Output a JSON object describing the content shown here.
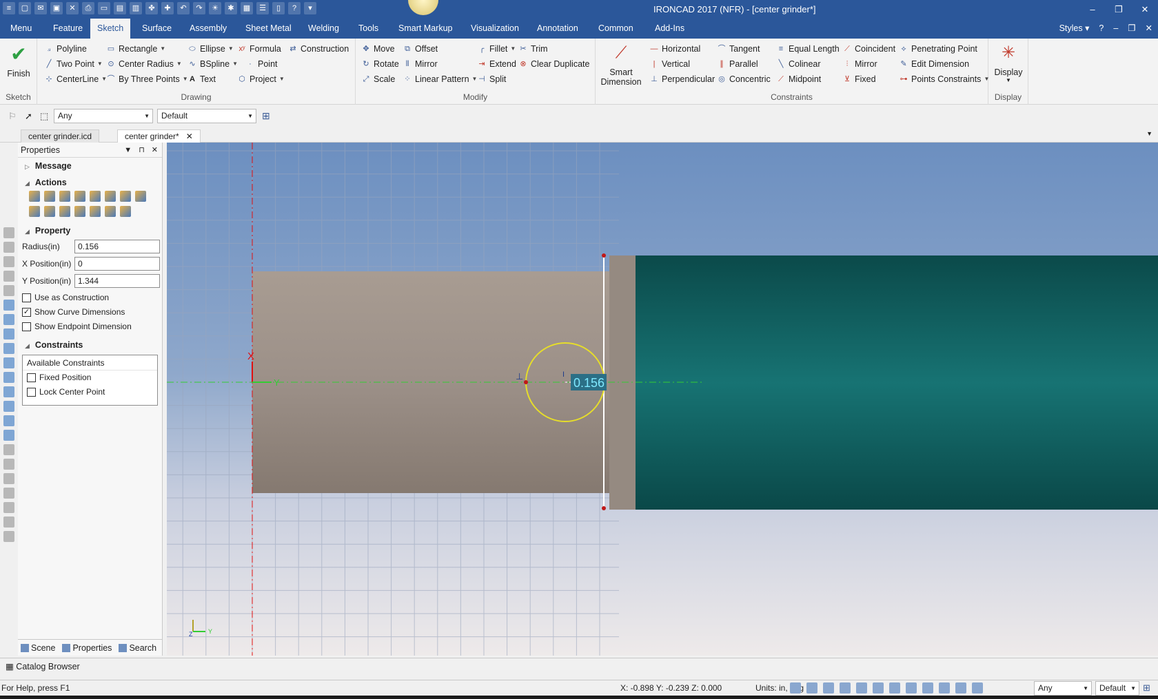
{
  "window": {
    "title": "IRONCAD 2017 (NFR) - [center grinder*]",
    "minimize": "–",
    "restore": "❐",
    "close": "✕"
  },
  "menu": {
    "tabs": [
      "Menu",
      "Feature",
      "Sketch",
      "Surface",
      "Assembly",
      "Sheet Metal",
      "Welding",
      "Tools",
      "Smart Markup",
      "Visualization",
      "Annotation",
      "Common",
      "Add-Ins"
    ],
    "active_tab": "Sketch",
    "styles_label": "Styles",
    "help_icon": "?"
  },
  "ribbon": {
    "sketch_group": {
      "label": "Sketch",
      "finish": "Finish"
    },
    "drawing_group": {
      "label": "Drawing",
      "polyline": "Polyline",
      "rectangle": "Rectangle",
      "ellipse": "Ellipse",
      "formula": "Formula",
      "construction": "Construction",
      "two_point": "Two Point",
      "center_radius": "Center Radius",
      "bspline": "BSpline",
      "point": "Point",
      "centerline": "CenterLine",
      "by_three_points": "By Three Points",
      "text": "Text",
      "project": "Project"
    },
    "modify_group": {
      "label": "Modify",
      "move": "Move",
      "offset": "Offset",
      "fillet": "Fillet",
      "trim": "Trim",
      "rotate": "Rotate",
      "mirror": "Mirror",
      "extend": "Extend",
      "clear_duplicate": "Clear Duplicate",
      "scale": "Scale",
      "linear_pattern": "Linear Pattern",
      "split": "Split"
    },
    "constraints_group": {
      "label": "Constraints",
      "smart_dimension": "Smart Dimension",
      "horizontal": "Horizontal",
      "tangent": "Tangent",
      "equal_length": "Equal Length",
      "coincident": "Coincident",
      "penetrating_point": "Penetrating Point",
      "vertical": "Vertical",
      "parallel": "Parallel",
      "colinear": "Colinear",
      "mirror": "Mirror",
      "edit_dimension": "Edit Dimension",
      "perpendicular": "Perpendicular",
      "concentric": "Concentric",
      "midpoint": "Midpoint",
      "fixed": "Fixed",
      "points_constraints": "Points Constraints"
    },
    "display_group": {
      "label": "Display",
      "display": "Display"
    }
  },
  "selection": {
    "filter_value": "Any",
    "style_value": "Default"
  },
  "doc_tabs": [
    {
      "label": "center grinder.icd",
      "active": false
    },
    {
      "label": "center grinder*",
      "active": true
    }
  ],
  "properties": {
    "title": "Properties",
    "message_label": "Message",
    "actions_label": "Actions",
    "property_label": "Property",
    "radius_label": "Radius(in)",
    "radius_value": "0.156",
    "x_label": "X Position(in)",
    "x_value": "0",
    "y_label": "Y Position(in)",
    "y_value": "1.344",
    "use_construction": "Use as Construction",
    "use_construction_checked": false,
    "show_curve_dims": "Show Curve Dimensions",
    "show_curve_dims_checked": true,
    "show_endpoint_dim": "Show Endpoint Dimension",
    "show_endpoint_dim_checked": false,
    "constraints_label": "Constraints",
    "available_constraints": "Available Constraints",
    "fixed_position": "Fixed Position",
    "lock_center_point": "Lock Center Point"
  },
  "panel_tabs": [
    "Scene",
    "Properties",
    "Search"
  ],
  "viewport": {
    "dimension_value": "0.156",
    "axis_x_label": "X",
    "axis_y_label": "Y",
    "triad_z": "Z",
    "triad_y": "Y",
    "colors": {
      "part_body": "#9b8f86",
      "teal_body": "#0f6666",
      "circle": "#e6dd2a",
      "dim_box": "#2b6f86",
      "dim_text": "#7fe8ff",
      "axis_red": "#e01010",
      "axis_green": "#33cc33"
    }
  },
  "catalog_browser": "Catalog Browser",
  "status": {
    "help": "For Help, press F1",
    "coords": "X: -0.898 Y: -0.239 Z: 0.000",
    "units": "Units: in, deg",
    "filter": "Any",
    "style": "Default"
  }
}
